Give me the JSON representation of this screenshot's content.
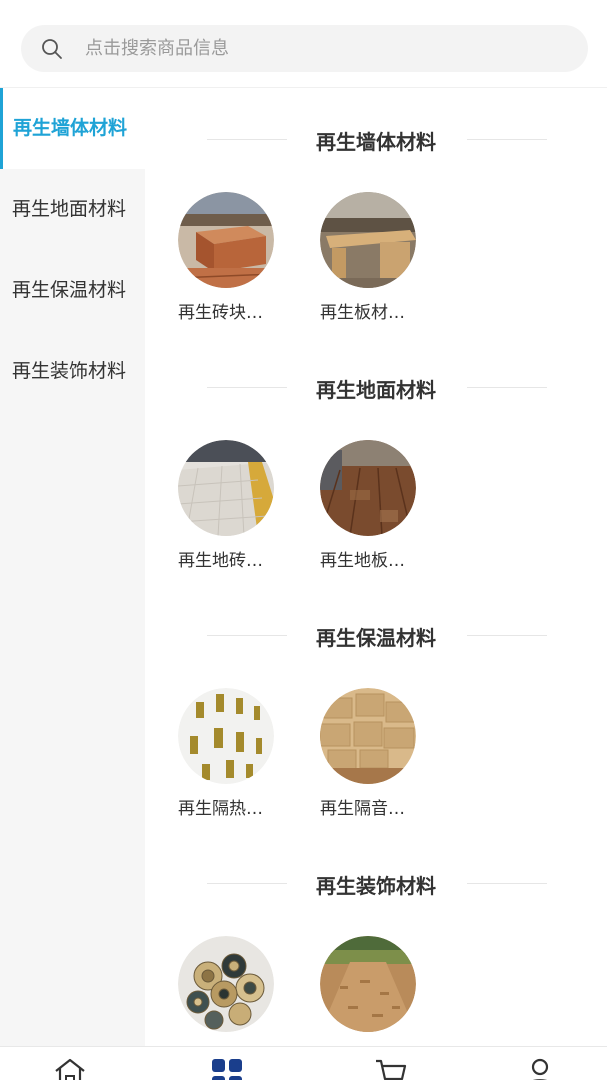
{
  "search": {
    "placeholder": "点击搜索商品信息",
    "icon": "search-icon"
  },
  "sidebar": {
    "items": [
      {
        "label": "再生墙体材料",
        "active": true
      },
      {
        "label": "再生地面材料",
        "active": false
      },
      {
        "label": "再生保温材料",
        "active": false
      },
      {
        "label": "再生装饰材料",
        "active": false
      }
    ]
  },
  "colors": {
    "accent": "#1fa3d6",
    "sidebar_bg": "#f6f6f6",
    "search_bg": "#f3f3f3"
  },
  "sections": [
    {
      "title": "再生墙体材料",
      "products": [
        {
          "name": "再生砖块…",
          "image": "brick"
        },
        {
          "name": "再生板材…",
          "image": "board"
        }
      ]
    },
    {
      "title": "再生地面材料",
      "products": [
        {
          "name": "再生地砖…",
          "image": "floor-tile"
        },
        {
          "name": "再生地板…",
          "image": "wood-floor"
        }
      ]
    },
    {
      "title": "再生保温材料",
      "products": [
        {
          "name": "再生隔热…",
          "image": "insulation-panel"
        },
        {
          "name": "再生隔音…",
          "image": "sound-panel"
        }
      ]
    },
    {
      "title": "再生装饰材料",
      "products": [
        {
          "name": "",
          "image": "decor-discs"
        },
        {
          "name": "",
          "image": "wood-chips"
        }
      ]
    }
  ],
  "tabbar": {
    "tabs": [
      {
        "icon": "home-icon",
        "active": false
      },
      {
        "icon": "category-icon",
        "active": true
      },
      {
        "icon": "cart-icon",
        "active": false
      },
      {
        "icon": "user-icon",
        "active": false
      }
    ]
  }
}
